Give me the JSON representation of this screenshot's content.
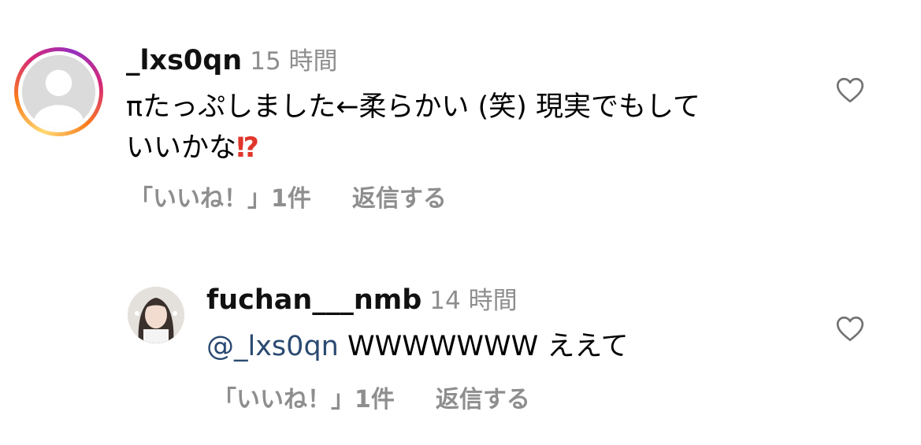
{
  "comments": [
    {
      "username": "_lxs0qn",
      "time": "15 時間",
      "text": "πたっぷしました←柔らかい (笑) 現実でもして\nいいかな",
      "text_emoji": "⁉",
      "likes_label": "「いいね！」1件",
      "reply_label": "返信する"
    },
    {
      "username": "fuchan___nmb",
      "time": "14 時間",
      "mention": "@_lxs0qn",
      "text": "WWWWWWW ええて",
      "likes_label": "「いいね！」1件",
      "reply_label": "返信する"
    }
  ],
  "colors": {
    "mention": "#2b4a71",
    "secondary_text": "#8e8e8e",
    "story_ring": [
      "#feda75",
      "#fa7e1e",
      "#d62976",
      "#962fbf"
    ],
    "emoji_red": "#e0362b"
  },
  "icons": {
    "like": "heart-outline-icon",
    "default_avatar": "default-avatar-icon"
  }
}
